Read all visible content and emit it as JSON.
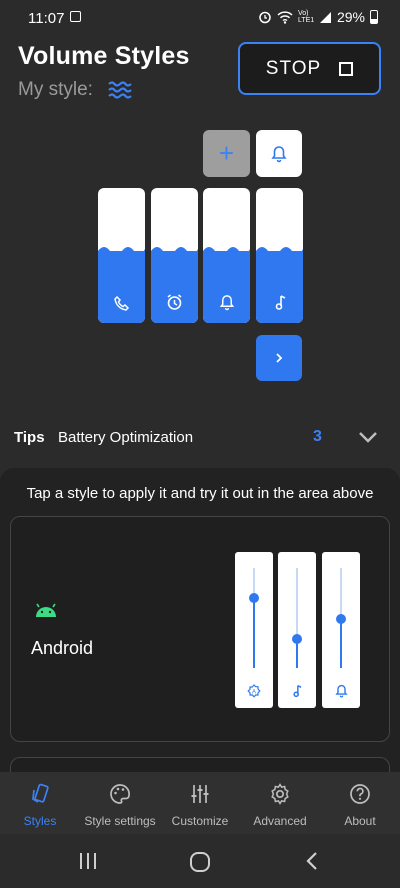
{
  "status_bar": {
    "time": "11:07",
    "network": "Vo) LTE1",
    "battery": "29%"
  },
  "header": {
    "title": "Volume Styles",
    "subtitle": "My style:",
    "stop_label": "STOP"
  },
  "preview": {
    "sliders": [
      {
        "name": "call",
        "icon": "phone-icon",
        "level": 0.55
      },
      {
        "name": "alarm",
        "icon": "alarm-icon",
        "level": 0.55
      },
      {
        "name": "notification",
        "icon": "bell-icon",
        "level": 0.55
      },
      {
        "name": "media",
        "icon": "music-note-icon",
        "level": 0.55
      }
    ]
  },
  "tips": {
    "label": "Tips",
    "text": "Battery Optimization",
    "count": "3"
  },
  "styles": {
    "hint": "Tap a style to apply it and try it out in the area above",
    "card": {
      "name": "Android",
      "sliders": [
        {
          "icon": "brightness-auto-icon",
          "level": 0.72
        },
        {
          "icon": "music-note-icon",
          "level": 0.32
        },
        {
          "icon": "bell-icon",
          "level": 0.5
        }
      ]
    }
  },
  "bottom_nav": [
    {
      "label": "Styles",
      "icon": "styles-icon",
      "active": true
    },
    {
      "label": "Style settings",
      "icon": "palette-icon",
      "active": false
    },
    {
      "label": "Customize",
      "icon": "sliders-icon",
      "active": false
    },
    {
      "label": "Advanced",
      "icon": "gear-icon",
      "active": false
    },
    {
      "label": "About",
      "icon": "help-icon",
      "active": false
    }
  ],
  "colors": {
    "accent": "#3b82f6",
    "background": "#2b2b2b",
    "fill": "#2f78f0",
    "android_green": "#3ddc84"
  }
}
